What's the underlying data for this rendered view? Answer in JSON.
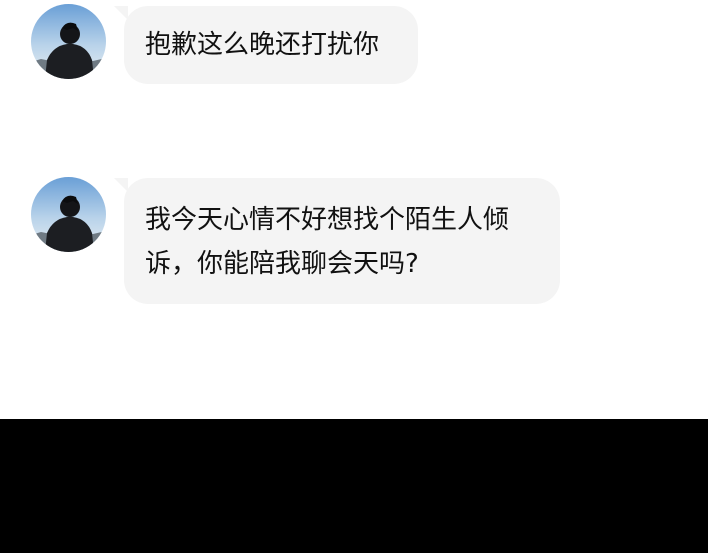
{
  "messages": [
    {
      "sender_avatar": "person-silhouette-avatar",
      "text": "抱歉这么晚还打扰你"
    },
    {
      "sender_avatar": "person-silhouette-avatar",
      "text": "我今天心情不好想找个陌生人倾\n诉，你能陪我聊会天吗?"
    }
  ],
  "colors": {
    "bubble_background": "#f4f4f4",
    "chat_background": "#ffffff",
    "bottom_background": "#000000",
    "text": "#111111"
  }
}
